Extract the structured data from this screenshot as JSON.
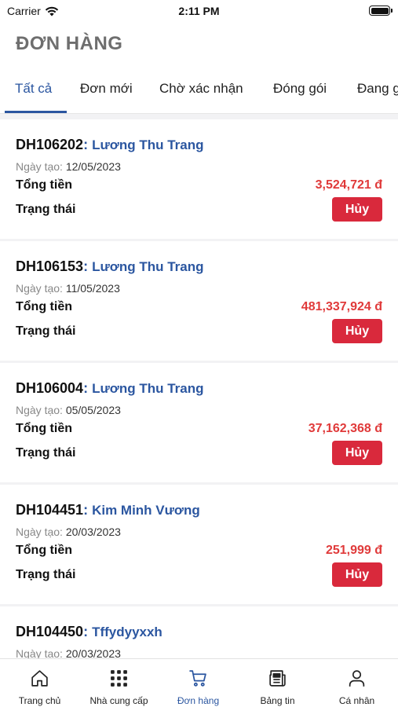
{
  "status_bar": {
    "carrier": "Carrier",
    "time": "2:11 PM"
  },
  "header": {
    "title": "ĐƠN HÀNG"
  },
  "tabs": [
    {
      "label": "Tất cả",
      "active": true
    },
    {
      "label": "Đơn mới",
      "active": false
    },
    {
      "label": "Chờ xác nhận",
      "active": false
    },
    {
      "label": "Đóng gói",
      "active": false
    },
    {
      "label": "Đang g",
      "active": false
    }
  ],
  "labels": {
    "date": "Ngày tạo:",
    "total": "Tổng tiền",
    "status": "Trạng thái",
    "cancel": "Hủy"
  },
  "orders": [
    {
      "code": "DH106202",
      "customer": "Lương Thu Trang",
      "date": "12/05/2023",
      "total": "3,524,721 đ"
    },
    {
      "code": "DH106153",
      "customer": "Lương Thu Trang",
      "date": "11/05/2023",
      "total": "481,337,924 đ"
    },
    {
      "code": "DH106004",
      "customer": "Lương Thu Trang",
      "date": "05/05/2023",
      "total": "37,162,368 đ"
    },
    {
      "code": "DH104451",
      "customer": "Kim Minh Vương",
      "date": "20/03/2023",
      "total": "251,999 đ"
    },
    {
      "code": "DH104450",
      "customer": "Tffydyyxxh",
      "date": "20/03/2023",
      "total": ""
    }
  ],
  "bottom_nav": [
    {
      "label": "Trang chủ",
      "icon": "home-icon",
      "active": false
    },
    {
      "label": "Nhà cung cấp",
      "icon": "grid-icon",
      "active": false
    },
    {
      "label": "Đơn hàng",
      "icon": "cart-icon",
      "active": true
    },
    {
      "label": "Bảng tin",
      "icon": "newspaper-icon",
      "active": false
    },
    {
      "label": "Cá nhân",
      "icon": "user-icon",
      "active": false
    }
  ],
  "colors": {
    "accent": "#2b56a0",
    "price": "#e03a3a",
    "cancel_button": "#d9293c"
  }
}
